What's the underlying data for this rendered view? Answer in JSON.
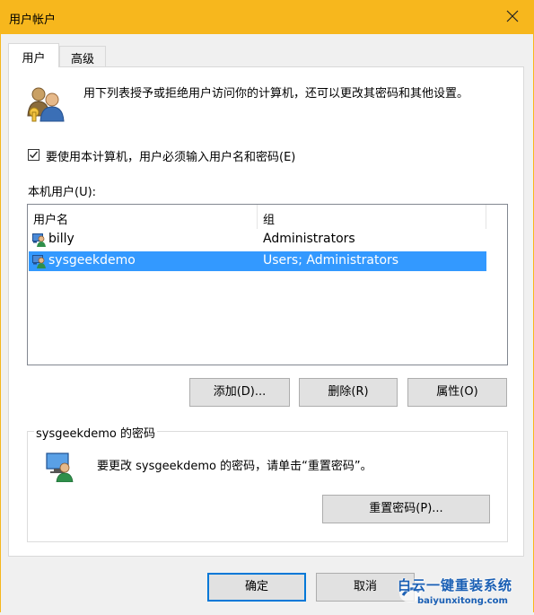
{
  "window": {
    "title": "用户帐户",
    "accent_color": "#f7b71d",
    "selection_color": "#3399ff"
  },
  "tabs": [
    {
      "label": "用户",
      "active": true
    },
    {
      "label": "高级",
      "active": false
    }
  ],
  "intro": {
    "icon": "users-icon",
    "text": "用下列表授予或拒绝用户访问你的计算机，还可以更改其密码和其他设置。"
  },
  "require_login": {
    "checked": true,
    "label": "要使用本计算机，用户必须输入用户名和密码(E)"
  },
  "users_list": {
    "label": "本机用户(U):",
    "columns": [
      "用户名",
      "组"
    ],
    "rows": [
      {
        "name": "billy",
        "group": "Administrators",
        "selected": false,
        "icon": "user-icon"
      },
      {
        "name": "sysgeekdemo",
        "group": "Users; Administrators",
        "selected": true,
        "icon": "user-icon"
      }
    ]
  },
  "buttons": {
    "add": "添加(D)...",
    "remove": "删除(R)",
    "properties": "属性(O)",
    "reset_password": "重置密码(P)...",
    "ok": "确定",
    "cancel": "取消"
  },
  "password_group": {
    "title": "sysgeekdemo 的密码",
    "icon": "monitor-user-icon",
    "text": "要更改 sysgeekdemo 的密码，请单击“重置密码”。"
  },
  "watermark": {
    "text_cn": "白云一键重装系统",
    "text_en": "baiyunxitong.com"
  }
}
